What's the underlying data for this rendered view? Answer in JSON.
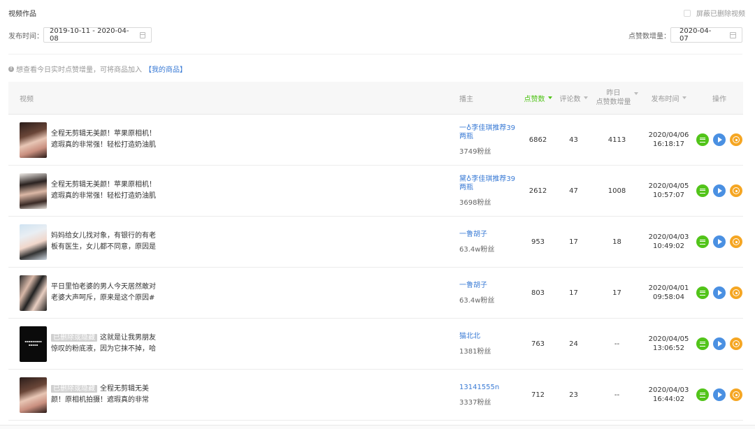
{
  "page": {
    "title": "视频作品",
    "hide_deleted_label": "屏蔽已删除视频"
  },
  "filters": {
    "publish_time_label": "发布时间：",
    "publish_range": "2019-10-11 - 2020-04-08",
    "likes_increase_label": "点赞数增量：",
    "likes_date": "2020-04-07"
  },
  "tip": {
    "text": "想查看今日实时点赞增量，可将商品加入",
    "link": "【我的商品】"
  },
  "table": {
    "headers": {
      "video": "视频",
      "anchor": "播主",
      "likes": "点赞数",
      "comments": "评论数",
      "yday_line1": "昨日",
      "yday_line2": "点赞数增量",
      "publish_time": "发布时间",
      "ops": "操作"
    },
    "rows": [
      {
        "thumb": "woman-red-lips",
        "deleted_tag": "",
        "desc": "全程无剪辑无美颜！苹果原相机！遮瑕真的非常强！轻松打造奶油肌伪...",
        "anchor": "一♁李佳琪推荐39两瓶",
        "fans": "3749粉丝",
        "likes": "6862",
        "comments": "43",
        "yday": "4113",
        "date": "2020/04/06",
        "time": "16:18:17"
      },
      {
        "thumb": "woman-dark-hair",
        "deleted_tag": "",
        "desc": "全程无剪辑无美颜！苹果原相机！遮瑕真的非常强！轻松打造奶油肌伪...",
        "anchor": "黛♁李佳琪推荐39两瓶",
        "fans": "3698粉丝",
        "likes": "2612",
        "comments": "47",
        "yday": "1008",
        "date": "2020/04/05",
        "time": "10:57:07"
      },
      {
        "thumb": "woman-light-bg",
        "deleted_tag": "",
        "desc": "妈妈给女儿找对象，有银行的有老板有医生，女儿都不同意，原因是#婚...",
        "anchor": "一鲁胡子",
        "fans": "63.4w粉丝",
        "likes": "953",
        "comments": "17",
        "yday": "18",
        "date": "2020/04/03",
        "time": "10:49:02"
      },
      {
        "thumb": "couple",
        "deleted_tag": "",
        "desc": "平日里怕老婆的男人今天居然敢对老婆大声呵斥，原来是这个原因#婚姻...",
        "anchor": "一鲁胡子",
        "fans": "63.4w粉丝",
        "likes": "803",
        "comments": "17",
        "yday": "17",
        "date": "2020/04/01",
        "time": "09:58:04"
      },
      {
        "thumb": "black-text",
        "deleted_tag": "已删除或隐藏",
        "desc": "这就是让我男朋友惊叹的粉底液，因为它抹不掉，哈哈...",
        "anchor": "猫北北",
        "fans": "1381粉丝",
        "likes": "763",
        "comments": "24",
        "yday": "--",
        "date": "2020/04/05",
        "time": "13:06:52"
      },
      {
        "thumb": "woman-red-lips",
        "deleted_tag": "已删除或隐藏",
        "desc": "全程无剪辑无美颜！原相机拍摄！遮瑕真的非常强！轻...",
        "anchor": "13141555n",
        "fans": "3337粉丝",
        "likes": "712",
        "comments": "23",
        "yday": "--",
        "date": "2020/04/03",
        "time": "16:44:02"
      }
    ]
  },
  "colors": {
    "accent_green": "#52c41a",
    "link_blue": "#3a7bd5",
    "op_blue": "#4a90e2",
    "op_orange": "#f5a623"
  }
}
